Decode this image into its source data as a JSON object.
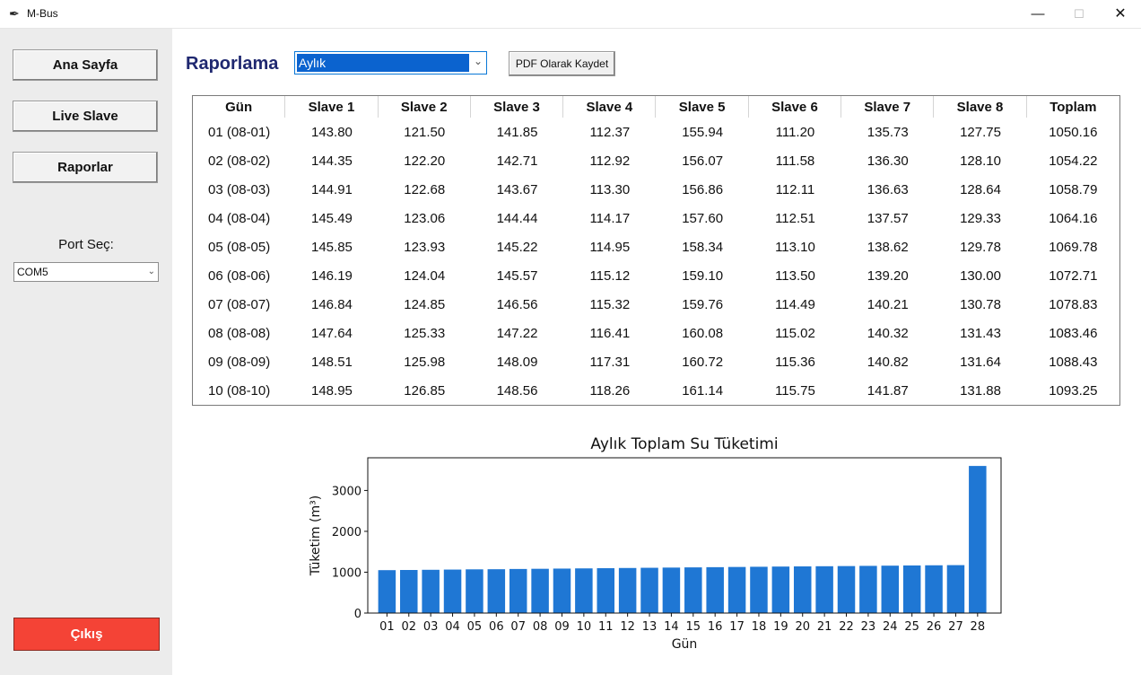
{
  "window": {
    "title": "M-Bus",
    "icon": "feather-icon",
    "minimize": "—",
    "maximize": "☐",
    "close": "✕"
  },
  "sidebar": {
    "buttons": [
      "Ana Sayfa",
      "Live Slave",
      "Raporlar"
    ],
    "port_label": "Port Seç:",
    "port_value": "COM5",
    "exit_label": "Çıkış",
    "exit_color": "#f44336"
  },
  "report": {
    "title": "Raporlama",
    "period_value": "Aylık",
    "pdf_button": "PDF Olarak Kaydet"
  },
  "table": {
    "columns": [
      "Gün",
      "Slave 1",
      "Slave 2",
      "Slave 3",
      "Slave 4",
      "Slave 5",
      "Slave 6",
      "Slave 7",
      "Slave 8",
      "Toplam"
    ],
    "rows": [
      [
        "01 (08-01)",
        "143.80",
        "121.50",
        "141.85",
        "112.37",
        "155.94",
        "111.20",
        "135.73",
        "127.75",
        "1050.16"
      ],
      [
        "02 (08-02)",
        "144.35",
        "122.20",
        "142.71",
        "112.92",
        "156.07",
        "111.58",
        "136.30",
        "128.10",
        "1054.22"
      ],
      [
        "03 (08-03)",
        "144.91",
        "122.68",
        "143.67",
        "113.30",
        "156.86",
        "112.11",
        "136.63",
        "128.64",
        "1058.79"
      ],
      [
        "04 (08-04)",
        "145.49",
        "123.06",
        "144.44",
        "114.17",
        "157.60",
        "112.51",
        "137.57",
        "129.33",
        "1064.16"
      ],
      [
        "05 (08-05)",
        "145.85",
        "123.93",
        "145.22",
        "114.95",
        "158.34",
        "113.10",
        "138.62",
        "129.78",
        "1069.78"
      ],
      [
        "06 (08-06)",
        "146.19",
        "124.04",
        "145.57",
        "115.12",
        "159.10",
        "113.50",
        "139.20",
        "130.00",
        "1072.71"
      ],
      [
        "07 (08-07)",
        "146.84",
        "124.85",
        "146.56",
        "115.32",
        "159.76",
        "114.49",
        "140.21",
        "130.78",
        "1078.83"
      ],
      [
        "08 (08-08)",
        "147.64",
        "125.33",
        "147.22",
        "116.41",
        "160.08",
        "115.02",
        "140.32",
        "131.43",
        "1083.46"
      ],
      [
        "09 (08-09)",
        "148.51",
        "125.98",
        "148.09",
        "117.31",
        "160.72",
        "115.36",
        "140.82",
        "131.64",
        "1088.43"
      ],
      [
        "10 (08-10)",
        "148.95",
        "126.85",
        "148.56",
        "118.26",
        "161.14",
        "115.75",
        "141.87",
        "131.88",
        "1093.25"
      ]
    ]
  },
  "chart_data": {
    "type": "bar",
    "title": "Aylık Toplam Su Tüketimi",
    "xlabel": "Gün",
    "ylabel": "Tüketim (m³)",
    "categories": [
      "01",
      "02",
      "03",
      "04",
      "05",
      "06",
      "07",
      "08",
      "09",
      "10",
      "11",
      "12",
      "13",
      "14",
      "15",
      "16",
      "17",
      "18",
      "19",
      "20",
      "21",
      "22",
      "23",
      "24",
      "25",
      "26",
      "27",
      "28"
    ],
    "values": [
      1050.16,
      1054.22,
      1058.79,
      1064.16,
      1069.78,
      1072.71,
      1078.83,
      1083.46,
      1088.43,
      1093.25,
      1098,
      1103,
      1108,
      1113,
      1118,
      1123,
      1128,
      1133,
      1138,
      1142,
      1146,
      1150,
      1155,
      1160,
      1165,
      1169,
      1173,
      3600
    ],
    "yticks": [
      0,
      1000,
      2000,
      3000
    ],
    "ylim": [
      0,
      3800
    ],
    "bar_color": "#1f77d4",
    "grid": false
  }
}
